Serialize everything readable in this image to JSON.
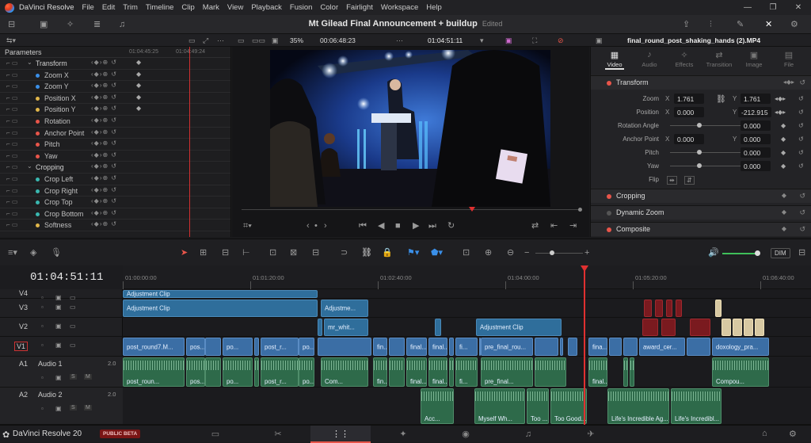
{
  "app": {
    "name": "DaVinci Resolve",
    "brand": "DaVinci Resolve 20",
    "beta": "PUBLIC BETA"
  },
  "menu": [
    "File",
    "Edit",
    "Trim",
    "Timeline",
    "Clip",
    "Mark",
    "View",
    "Playback",
    "Fusion",
    "Color",
    "Fairlight",
    "Workspace",
    "Help"
  ],
  "project": {
    "title": "Mt Gilead Final Announcement + buildup",
    "status": "Edited"
  },
  "viewer": {
    "zoom": "35%",
    "duration": "00:06:48:23",
    "timecode": "01:04:51:11",
    "playhead_fraction": 0.68
  },
  "inspector_left": {
    "header": "Parameters",
    "ruler": [
      "01:04:45:25",
      "01:04:49:24"
    ],
    "rows": [
      {
        "label": "Transform",
        "section": true
      },
      {
        "label": "Zoom X",
        "color": "#3a8fe8"
      },
      {
        "label": "Zoom Y",
        "color": "#3a8fe8"
      },
      {
        "label": "Position X",
        "color": "#e0b64a"
      },
      {
        "label": "Position Y",
        "color": "#e0b64a"
      },
      {
        "label": "Rotation",
        "color": "#e8554a"
      },
      {
        "label": "Anchor Point",
        "color": "#e8554a"
      },
      {
        "label": "Pitch",
        "color": "#e8554a"
      },
      {
        "label": "Yaw",
        "color": "#e8554a"
      },
      {
        "label": "Cropping",
        "section": true
      },
      {
        "label": "Crop Left",
        "color": "#3ab8b0"
      },
      {
        "label": "Crop Right",
        "color": "#3ab8b0"
      },
      {
        "label": "Crop Top",
        "color": "#3ab8b0"
      },
      {
        "label": "Crop Bottom",
        "color": "#3ab8b0"
      },
      {
        "label": "Softness",
        "color": "#e0b64a"
      }
    ]
  },
  "inspector_right": {
    "filename": "final_round_post_shaking_hands (2).MP4",
    "tabs": [
      "Video",
      "Audio",
      "Effects",
      "Transition",
      "Image",
      "File"
    ],
    "active_tab": "Video",
    "transform_title": "Transform",
    "zoom": {
      "label": "Zoom",
      "x": "1.761",
      "y": "1.761"
    },
    "position": {
      "label": "Position",
      "x": "0.000",
      "y": "-212.915"
    },
    "rotation": {
      "label": "Rotation Angle",
      "value": "0.000"
    },
    "anchor": {
      "label": "Anchor Point",
      "x": "0.000",
      "y": "0.000"
    },
    "pitch": {
      "label": "Pitch",
      "value": "0.000"
    },
    "yaw": {
      "label": "Yaw",
      "value": "0.000"
    },
    "flip": {
      "label": "Flip"
    },
    "axis_x": "X",
    "axis_y": "Y",
    "sections": [
      "Cropping",
      "Dynamic Zoom",
      "Composite"
    ]
  },
  "timeline": {
    "timecode": "01:04:51:11",
    "ruler": [
      "01:00:00:00",
      "01:01:20:00",
      "01:02:40:00",
      "01:04:00:00",
      "01:05:20:00",
      "01:06:40:00"
    ],
    "dim": "DIM",
    "tracks": [
      {
        "id": "V4",
        "name": ""
      },
      {
        "id": "V3",
        "name": ""
      },
      {
        "id": "V2",
        "name": ""
      },
      {
        "id": "V1",
        "name": ""
      },
      {
        "id": "A1",
        "name": "Audio 1",
        "level": "2.0"
      },
      {
        "id": "A2",
        "name": "Audio 2",
        "level": "2.0"
      }
    ],
    "clips": {
      "v4": [
        {
          "n": "Adjustment Clip"
        }
      ],
      "v3": [
        {
          "n": "Adjustment Clip"
        },
        {
          "n": "Adjustme..."
        }
      ],
      "v2": [
        {
          "n": "mr_whit..."
        },
        {
          "n": "Adjustment Clip"
        }
      ],
      "v1": [
        "post_round7.M...",
        "pos...",
        "po...",
        "post_r...",
        "po...",
        "fin...",
        "final...",
        "final...",
        "fi...",
        "pre_final_rou...",
        "fina...",
        "award_cer...",
        "doxology_pra..."
      ],
      "a1": [
        "post_roun...",
        "pos...",
        "po...",
        "post_r...",
        "po...",
        "Com...",
        "fin...",
        "final...",
        "final...",
        "fi...",
        "pre_final...",
        "final...",
        "Compou..."
      ],
      "a2": [
        "Acc...",
        "Myself Wh...",
        "Too ...",
        "Too Good...",
        "Life's Incredible Ag...",
        "Life's Incredibl..."
      ]
    }
  },
  "pages": [
    "media",
    "cut",
    "edit",
    "fusion",
    "color",
    "fairlight",
    "deliver"
  ],
  "active_page": "edit"
}
